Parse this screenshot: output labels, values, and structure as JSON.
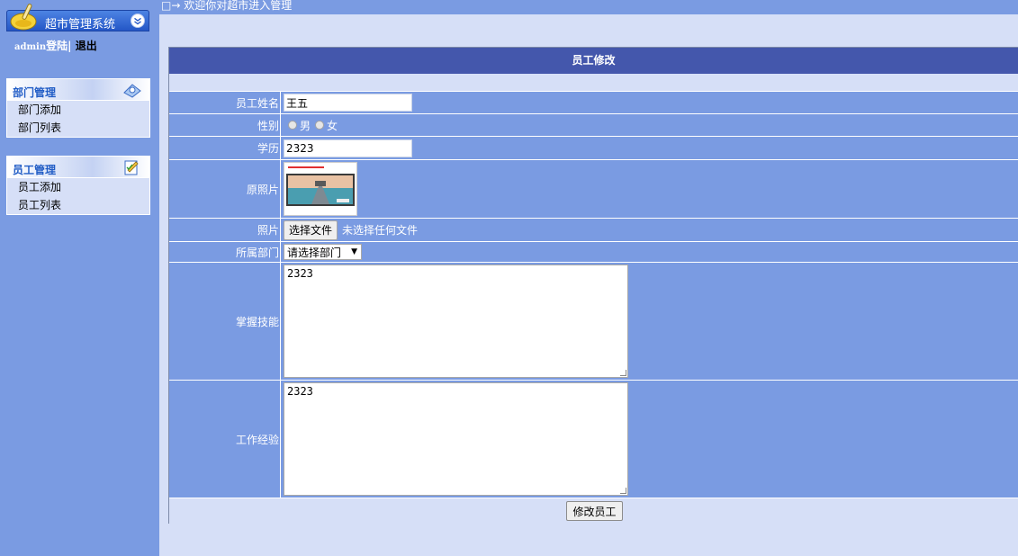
{
  "app": {
    "title": "超市管理系统"
  },
  "login": {
    "user": "admin",
    "action": "登陆",
    "separator": "|",
    "logout": "退出"
  },
  "sidebar": {
    "groups": [
      {
        "title": "部门管理",
        "icon": "dept-icon",
        "items": [
          "部门添加",
          "部门列表"
        ]
      },
      {
        "title": "员工管理",
        "icon": "edit-icon",
        "items": [
          "员工添加",
          "员工列表"
        ]
      }
    ]
  },
  "top": {
    "welcome": "□→ 欢迎你对超市进入管理"
  },
  "form": {
    "title": "员工修改",
    "name_label": "员工姓名",
    "name_value": "王五",
    "gender_label": "性别",
    "gender_male": "男",
    "gender_female": "女",
    "edu_label": "学历",
    "edu_value": "2323",
    "orig_photo_label": "原照片",
    "photo_label": "照片",
    "file_button": "选择文件",
    "file_hint": "未选择任何文件",
    "dept_label": "所属部门",
    "dept_selected": "请选择部门",
    "skills_label": "掌握技能",
    "skills_value": "2323",
    "experience_label": "工作经验",
    "experience_value": "2323",
    "submit_label": "修改员工"
  },
  "colors": {
    "sidebar_bg": "#7a9be2",
    "header_bg": "#4457ac",
    "page_bg": "#d6dff7",
    "row_bg": "#7a9be2"
  }
}
